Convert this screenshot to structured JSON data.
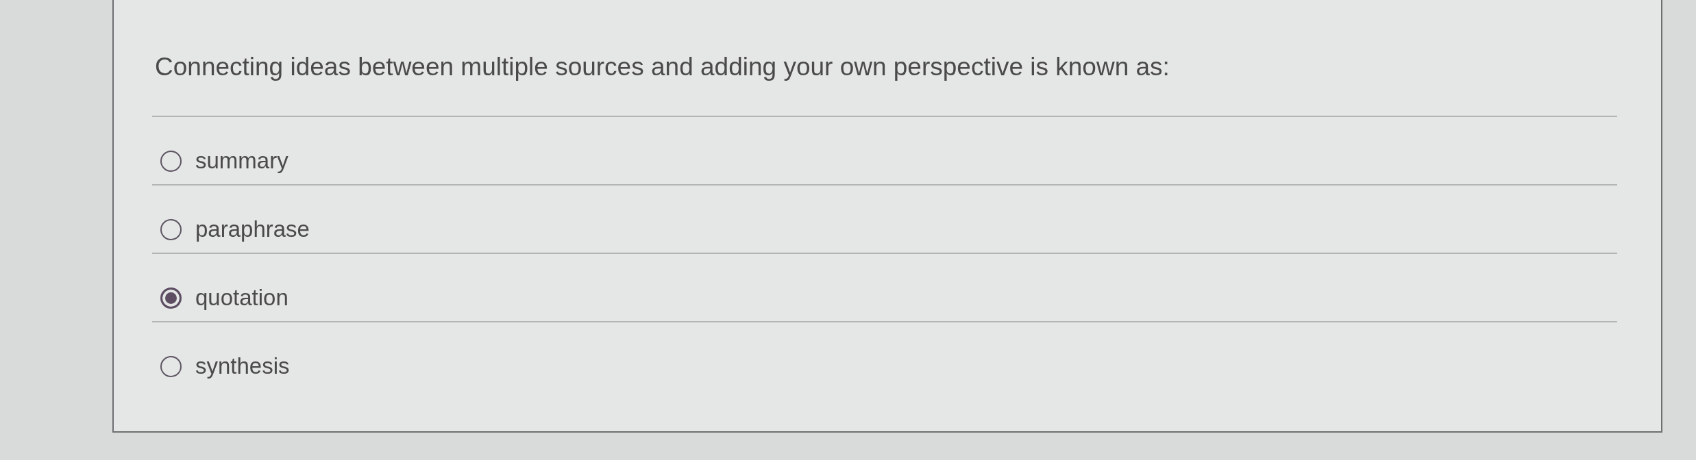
{
  "question": {
    "text": "Connecting ideas between multiple sources and adding your own perspective is known as:"
  },
  "options": [
    {
      "label": "summary",
      "selected": false
    },
    {
      "label": "paraphrase",
      "selected": false
    },
    {
      "label": "quotation",
      "selected": true
    },
    {
      "label": "synthesis",
      "selected": false
    }
  ]
}
